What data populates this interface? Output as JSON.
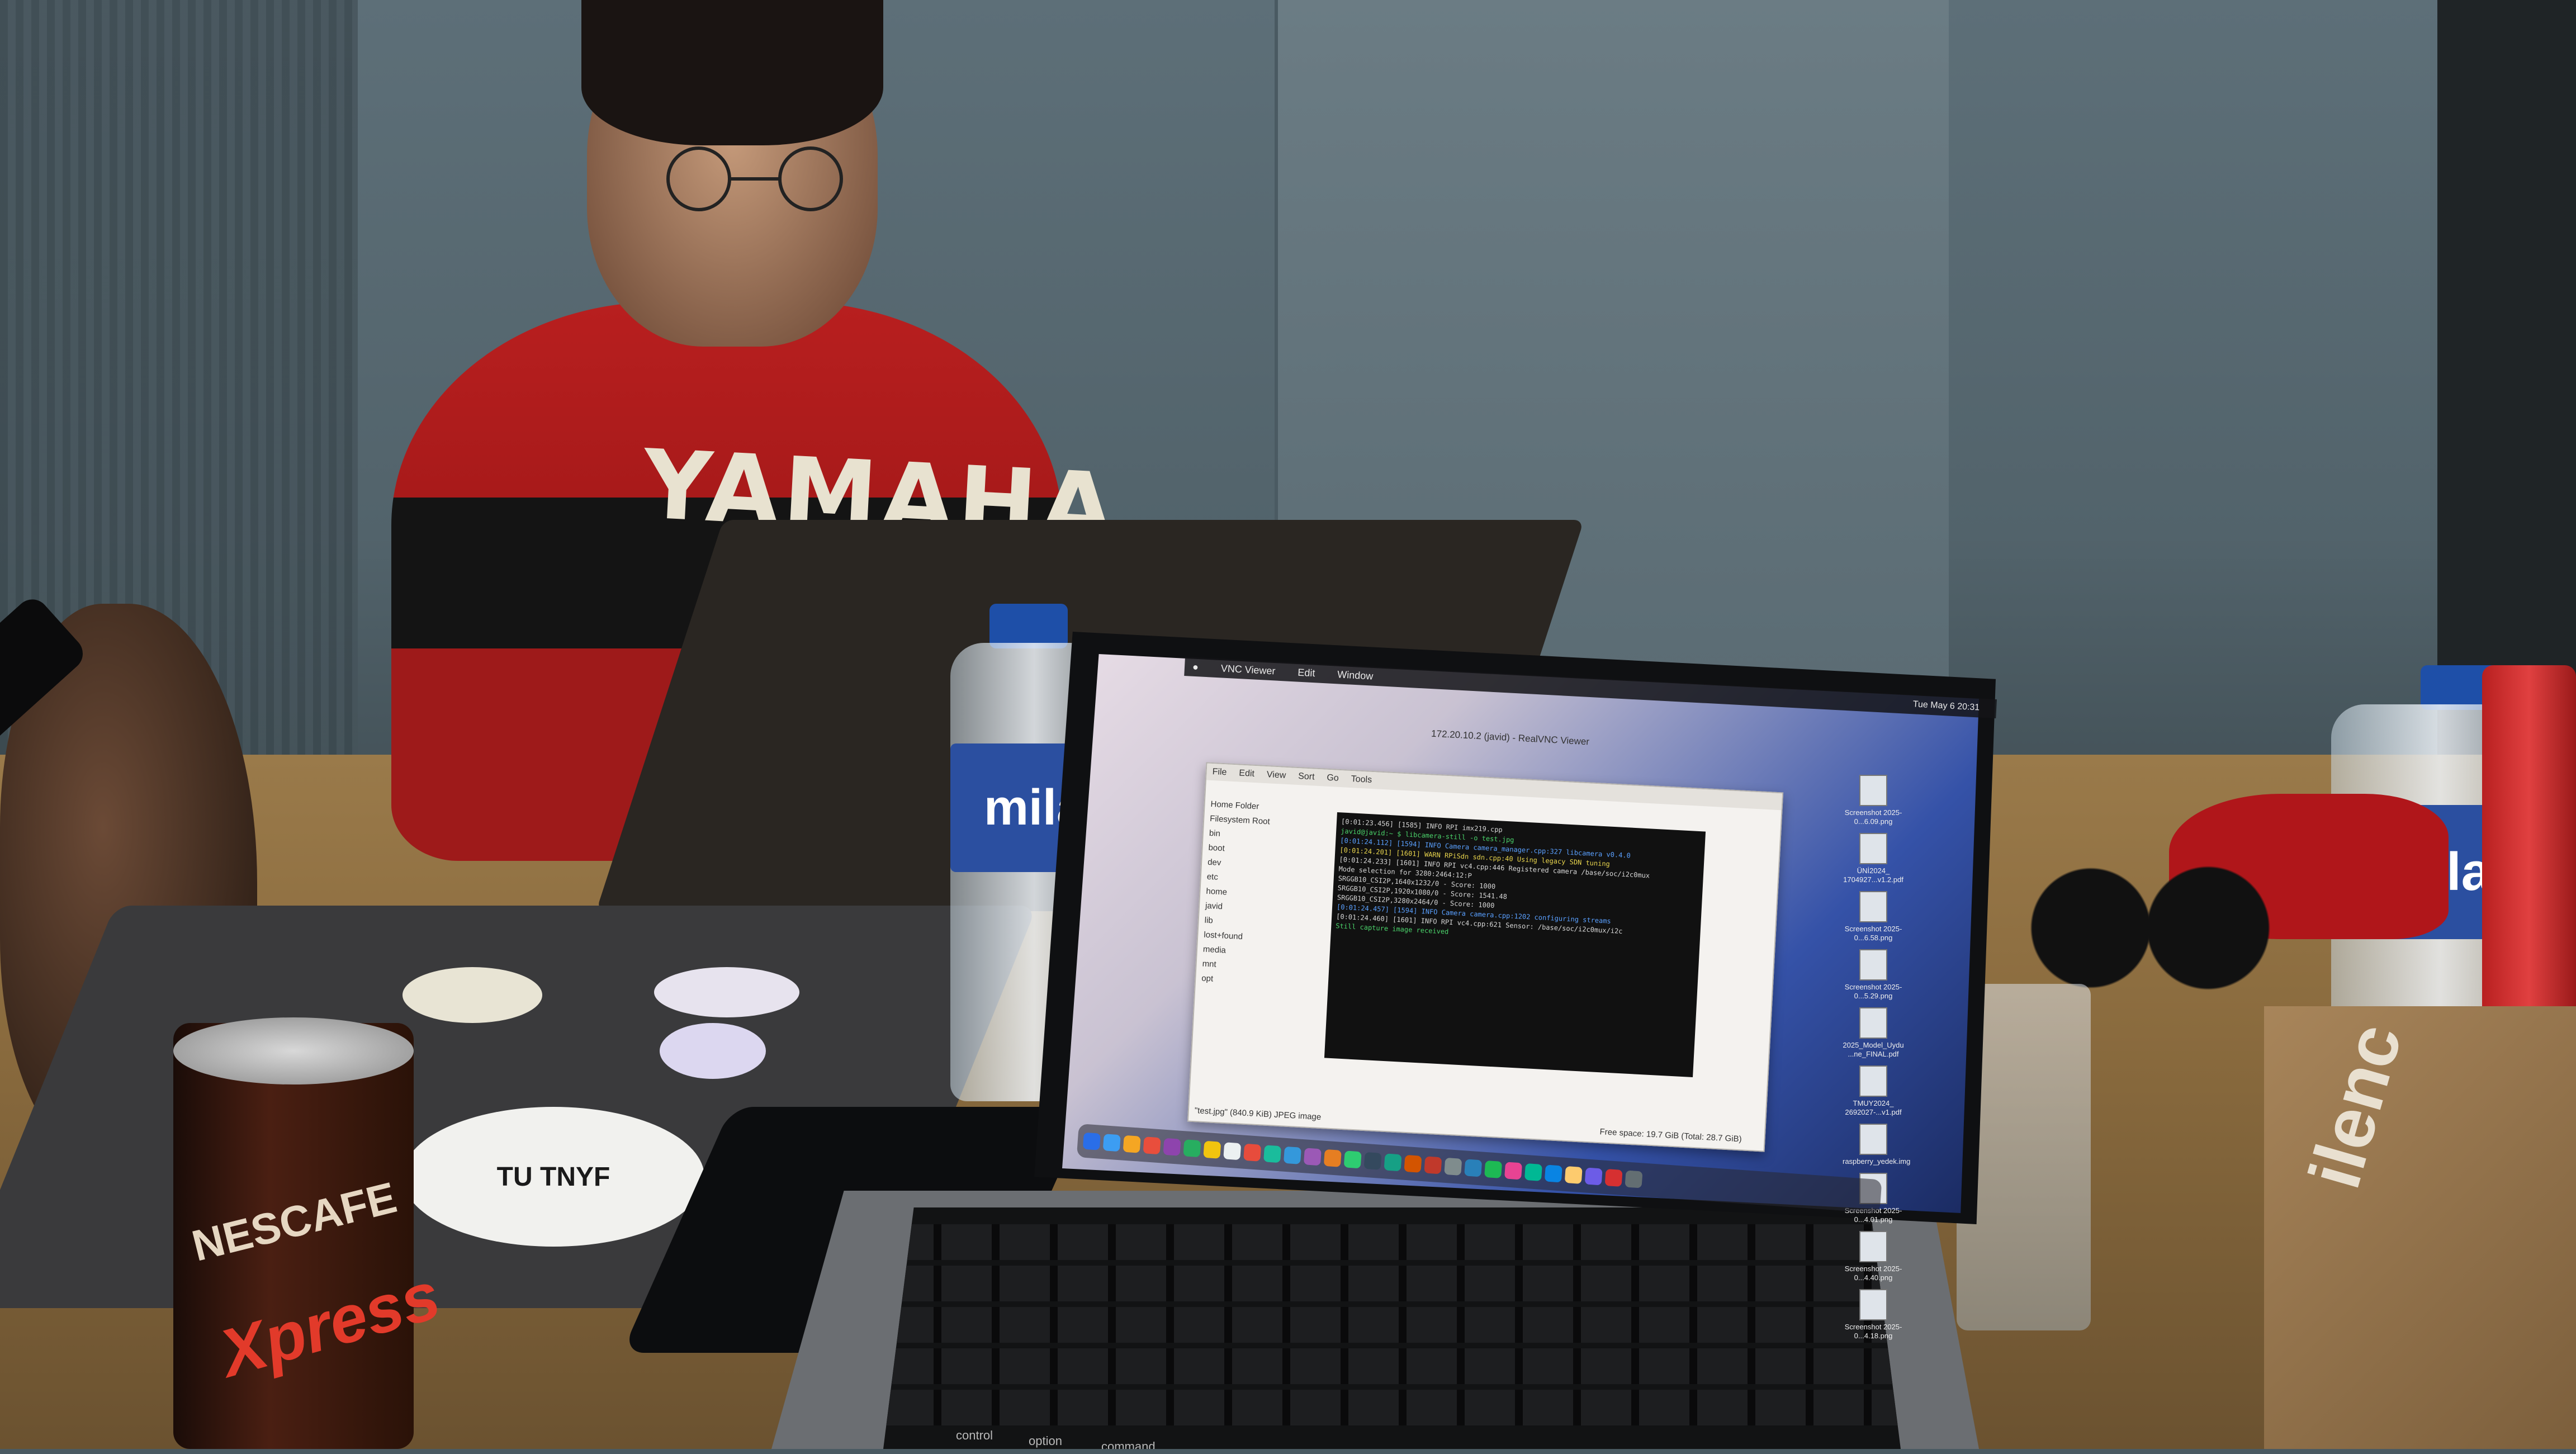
{
  "scene": {
    "sweater_brand": "YAMAHA",
    "can_brand": "NESCAFE",
    "can_product": "Xpress",
    "bottle_brand": "mila",
    "box_brand": "ilenc",
    "left_laptop_sticker": "TU TNYF"
  },
  "mac": {
    "menubar": {
      "app": "VNC Viewer",
      "items": [
        "Edit",
        "Window"
      ],
      "clock": "Tue May 6  20:31"
    },
    "vnc_window_title": "172.20.10.2 (javid) - RealVNC Viewer",
    "file_manager": {
      "menus": [
        "File",
        "Edit",
        "View",
        "Sort",
        "Go",
        "Tools"
      ],
      "sidebar": [
        "Home Folder",
        "Filesystem Root",
        "bin",
        "boot",
        "dev",
        "etc",
        "home",
        "javid",
        "lib",
        "lost+found",
        "media",
        "mnt",
        "opt"
      ],
      "status": "\"test.jpg\" (840.9 KiB) JPEG image",
      "free_space": "Free space: 19.7 GiB (Total: 28.7 GiB)",
      "file_name": "test.jpg"
    },
    "terminal_lines": [
      {
        "text": "[0:01:23.456] [1585]  INFO RPI imx219.cpp",
        "cls": ""
      },
      {
        "text": "javid@javid:~ $ libcamera-still -o test.jpg",
        "cls": "g"
      },
      {
        "text": "[0:01:24.112] [1594]  INFO Camera camera_manager.cpp:327 libcamera v0.4.0",
        "cls": "b"
      },
      {
        "text": "[0:01:24.201] [1601]  WARN RPiSdn sdn.cpp:40 Using legacy SDN tuning",
        "cls": "y"
      },
      {
        "text": "[0:01:24.233] [1601]  INFO RPI vc4.cpp:446 Registered camera /base/soc/i2c0mux",
        "cls": ""
      },
      {
        "text": "Mode selection for 3280:2464:12:P",
        "cls": ""
      },
      {
        "text": "    SRGGB10_CSI2P,1640x1232/0 - Score: 1000",
        "cls": ""
      },
      {
        "text": "    SRGGB10_CSI2P,1920x1080/0 - Score: 1541.48",
        "cls": ""
      },
      {
        "text": "    SRGGB10_CSI2P,3280x2464/0 - Score: 1000",
        "cls": ""
      },
      {
        "text": "[0:01:24.457] [1594]  INFO Camera camera.cpp:1202 configuring streams",
        "cls": "b"
      },
      {
        "text": "[0:01:24.460] [1601]  INFO RPI vc4.cpp:621 Sensor: /base/soc/i2c0mux/i2c",
        "cls": ""
      },
      {
        "text": "Still capture image received",
        "cls": "g"
      }
    ],
    "desktop_files": [
      "Screenshot 2025-0...6.09.png",
      "ÜNİ2024_ 1704927...v1.2.pdf",
      "Screenshot 2025-0...6.58.png",
      "Screenshot 2025-0...5.29.png",
      "2025_Model_Uydu ...ne_FINAL.pdf",
      "TMUY2024_ 2692027-...v1.pdf",
      "raspberry_yedek.img",
      "Screenshot 2025-0...4.01.png",
      "Screenshot 2025-0...4.40.png",
      "Screenshot 2025-0...4.18.png"
    ],
    "dock_colors": [
      "#2a6ee8",
      "#3c9df2",
      "#f5a623",
      "#e94e3c",
      "#8e44ad",
      "#27ae60",
      "#f1c40f",
      "#ecf0f1",
      "#e74c3c",
      "#1abc9c",
      "#3498db",
      "#9b59b6",
      "#e67e22",
      "#2ecc71",
      "#34495e",
      "#16a085",
      "#d35400",
      "#c0392b",
      "#7f8c8d",
      "#2980b9",
      "#1db954",
      "#e84393",
      "#00b894",
      "#0984e3",
      "#fdcb6e",
      "#6c5ce7",
      "#d63031",
      "#636e72"
    ],
    "keyboard_labels": [
      "control",
      "option",
      "command"
    ]
  }
}
